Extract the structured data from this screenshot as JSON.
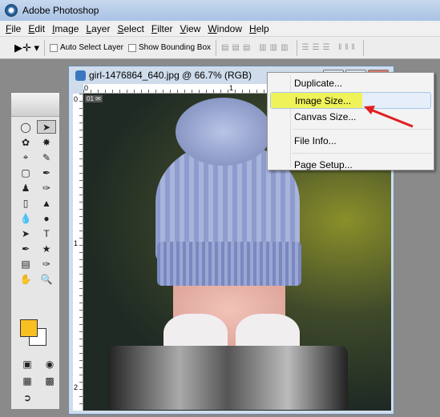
{
  "app": {
    "title": "Adobe Photoshop"
  },
  "menubar": [
    "File",
    "Edit",
    "Image",
    "Layer",
    "Select",
    "Filter",
    "View",
    "Window",
    "Help"
  ],
  "options": {
    "auto_select": "Auto Select Layer",
    "bounding_box": "Show Bounding Box",
    "auto_select_checked": false,
    "bounding_box_checked": false
  },
  "document": {
    "title": "girl-1476864_640.jpg @ 66.7% (RGB)",
    "ruler_top": [
      "0",
      "1"
    ],
    "ruler_left": [
      "0",
      "1",
      "2"
    ]
  },
  "context_menu": {
    "items": [
      "Duplicate...",
      "Image Size...",
      "Canvas Size...",
      "File Info...",
      "Page Setup..."
    ],
    "highlighted": "Image Size..."
  },
  "colors": {
    "foreground": "#f9c022",
    "background": "#ffffff",
    "highlight": "#f0f25a",
    "arrow": "#e02020"
  }
}
